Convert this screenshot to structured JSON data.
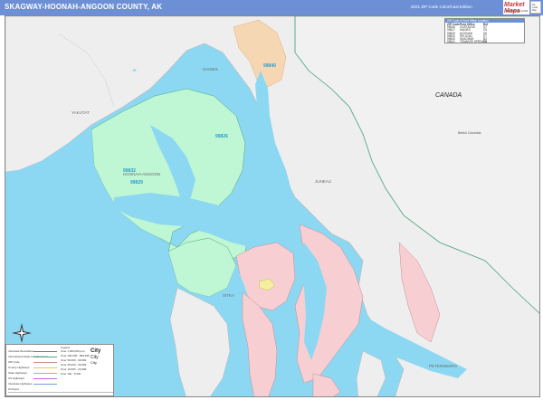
{
  "header": {
    "title": "SKAGWAY-HOONAH-ANGOON COUNTY, AK",
    "edition": "2021 ZIP Code Color/Cast Edition",
    "brand_logo": "Market Maps",
    "brand_sub": "MAPSALES.COM",
    "brand_side": "Zip Code Map"
  },
  "zip_table": {
    "heading": "ZIP Code & Post Office Location",
    "columns": [
      "ZIP Code",
      "Post Office",
      "Ref"
    ],
    "rows": [
      [
        "99826",
        "GUSTAVUS",
        "D7"
      ],
      [
        "99827",
        "HAINES",
        "C5"
      ],
      [
        "99829",
        "HOONAH",
        "D6"
      ],
      [
        "99832",
        "PELICAN",
        "E7"
      ],
      [
        "99840",
        "SKAGWAY",
        "B3"
      ],
      [
        "99841",
        "TENAKEE SPRINGS",
        "E6"
      ]
    ]
  },
  "map_labels": {
    "canada": "CANADA",
    "yakutat": "YAKUTAT",
    "haines": "HAINES",
    "juneau": "JUNEAU",
    "hoonah_angoon": "HOONAH-ANGOON",
    "sitka": "SITKA",
    "petersburg": "PETERSBURG",
    "canada_small": "British Columbia"
  },
  "zip_labels": {
    "z99840": "99840",
    "z99826": "99826",
    "z99832": "99832",
    "z99829": "99829"
  },
  "legend": {
    "title": "Legend",
    "items": [
      "Interstate Boundaries",
      "International State and Provinces",
      "ZIP Code",
      "County Highways",
      "State Highways",
      "US Highways",
      "Interstate Highways",
      "ZI Airport"
    ],
    "sizes": [
      "Over 1,000,000 pop",
      "Over 100,000 - 999,999",
      "Over 50,000 - 99,999",
      "Over 25,000 - 49,999",
      "Over 10,000 - 24,999",
      "Over 10k - 5,000"
    ],
    "city_label": "City"
  },
  "colors": {
    "header": "#6d8fd6",
    "water": "#8cd8f3",
    "land": "#eeeeee",
    "zip_green": "#bff7d4",
    "zip_pink": "#f7cfd3",
    "zip_orange": "#f5d7b3",
    "zip_yellow": "#f5eea0",
    "border_green": "#4aa67b"
  }
}
